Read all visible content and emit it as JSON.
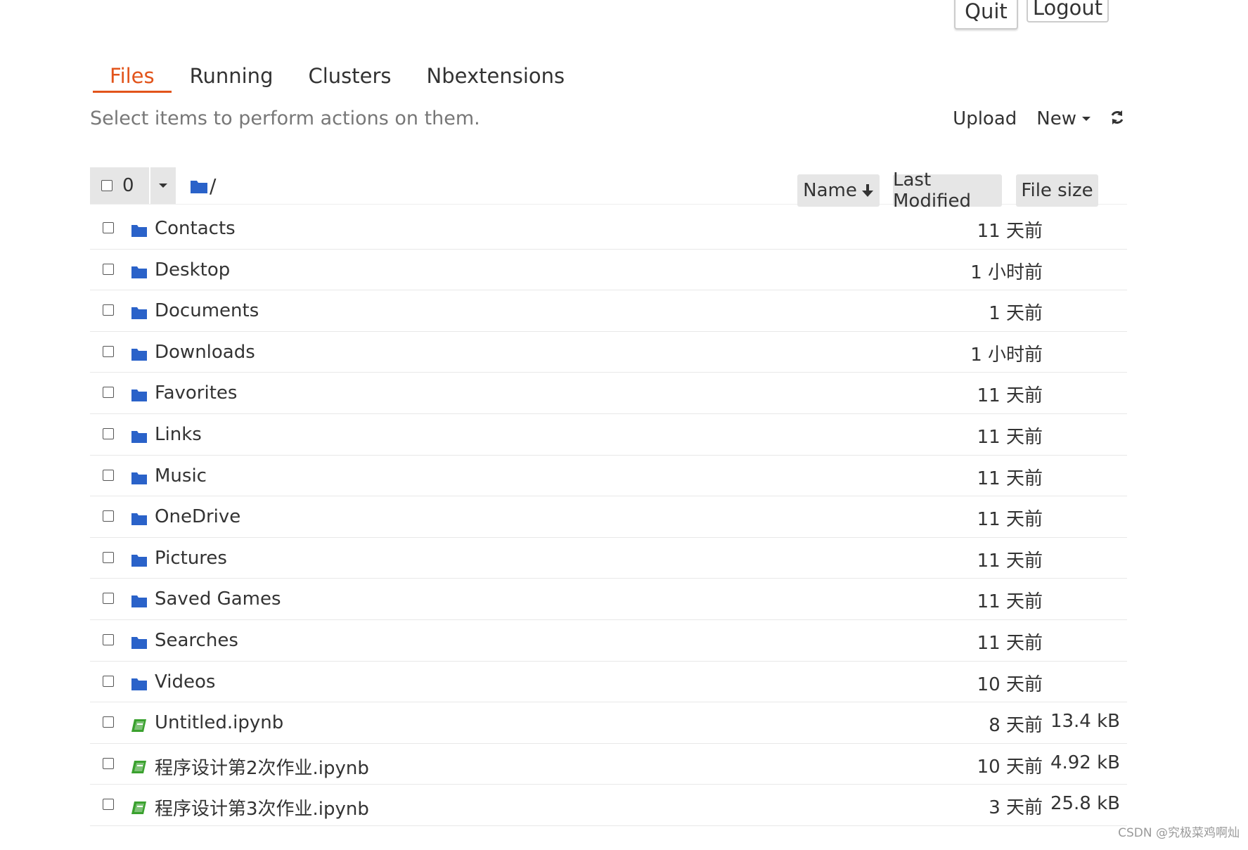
{
  "header": {
    "quit_label": "Quit",
    "logout_label": "Logout"
  },
  "tabs": [
    {
      "label": "Files",
      "active": true
    },
    {
      "label": "Running",
      "active": false
    },
    {
      "label": "Clusters",
      "active": false
    },
    {
      "label": "Nbextensions",
      "active": false
    }
  ],
  "toolbar": {
    "hint": "Select items to perform actions on them.",
    "upload_label": "Upload",
    "new_label": "New",
    "refresh_icon": "refresh-icon"
  },
  "list_header": {
    "selected_count": "0",
    "breadcrumb": "/",
    "sort_name": "Name",
    "sort_modified": "Last Modified",
    "sort_size": "File size"
  },
  "files": [
    {
      "type": "folder",
      "name": "Contacts",
      "modified": "11 天前",
      "size": ""
    },
    {
      "type": "folder",
      "name": "Desktop",
      "modified": "1 小时前",
      "size": ""
    },
    {
      "type": "folder",
      "name": "Documents",
      "modified": "1 天前",
      "size": ""
    },
    {
      "type": "folder",
      "name": "Downloads",
      "modified": "1 小时前",
      "size": ""
    },
    {
      "type": "folder",
      "name": "Favorites",
      "modified": "11 天前",
      "size": ""
    },
    {
      "type": "folder",
      "name": "Links",
      "modified": "11 天前",
      "size": ""
    },
    {
      "type": "folder",
      "name": "Music",
      "modified": "11 天前",
      "size": ""
    },
    {
      "type": "folder",
      "name": "OneDrive",
      "modified": "11 天前",
      "size": ""
    },
    {
      "type": "folder",
      "name": "Pictures",
      "modified": "11 天前",
      "size": ""
    },
    {
      "type": "folder",
      "name": "Saved Games",
      "modified": "11 天前",
      "size": ""
    },
    {
      "type": "folder",
      "name": "Searches",
      "modified": "11 天前",
      "size": ""
    },
    {
      "type": "folder",
      "name": "Videos",
      "modified": "10 天前",
      "size": ""
    },
    {
      "type": "notebook",
      "name": "Untitled.ipynb",
      "modified": "8 天前",
      "size": "13.4 kB"
    },
    {
      "type": "notebook",
      "name": "程序设计第2次作业.ipynb",
      "modified": "10 天前",
      "size": "4.92 kB"
    },
    {
      "type": "notebook",
      "name": "程序设计第3次作业.ipynb",
      "modified": "3 天前",
      "size": "25.8 kB"
    }
  ],
  "colors": {
    "accent": "#e2541b",
    "folder": "#2a62c9",
    "notebook": "#3aa12e"
  },
  "watermark": "CSDN @究极菜鸡啊灿"
}
